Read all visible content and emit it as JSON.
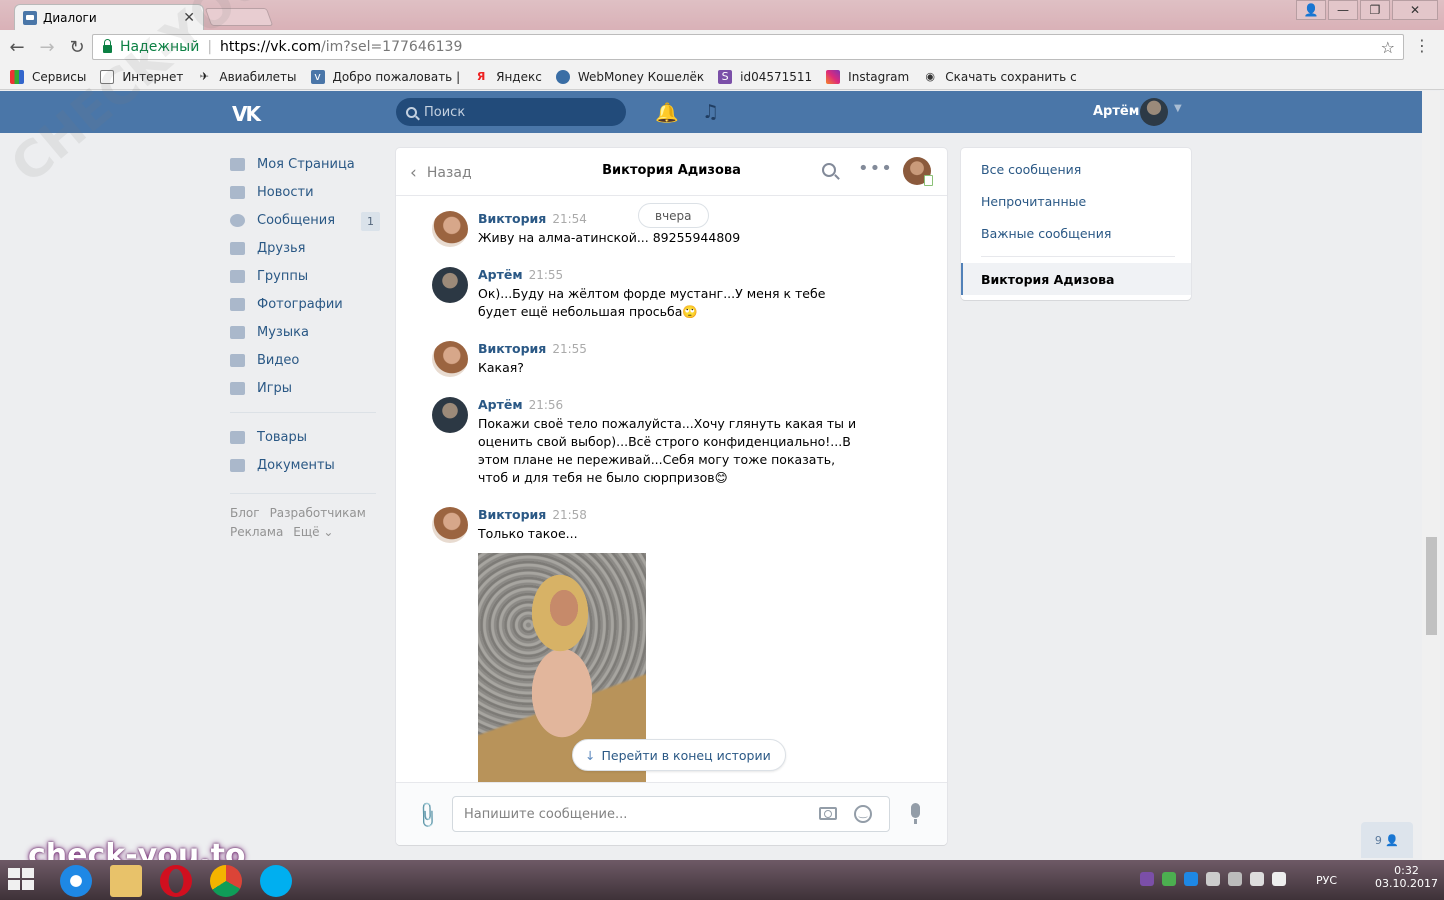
{
  "browser": {
    "tab_title": "Диалоги",
    "secure_label": "Надежный",
    "url_host": "https://vk.com",
    "url_rest": "/im?sel=177646139",
    "bookmarks": [
      "Сервисы",
      "Интернет",
      "Авиабилеты",
      "Добро пожаловать |",
      "Яндекс",
      "WebMoney Кошелёк",
      "id04571511",
      "Instagram",
      "Скачать сохранить с"
    ]
  },
  "vk_header": {
    "logo": "vk",
    "search_placeholder": "Поиск",
    "user_name": "Артём"
  },
  "left_menu": {
    "items": [
      {
        "label": "Моя Страница",
        "icon": "home-icon"
      },
      {
        "label": "Новости",
        "icon": "news-icon"
      },
      {
        "label": "Сообщения",
        "icon": "messages-icon",
        "count": "1"
      },
      {
        "label": "Друзья",
        "icon": "friends-icon"
      },
      {
        "label": "Группы",
        "icon": "groups-icon"
      },
      {
        "label": "Фотографии",
        "icon": "photos-icon"
      },
      {
        "label": "Музыка",
        "icon": "music-icon"
      },
      {
        "label": "Видео",
        "icon": "video-icon"
      },
      {
        "label": "Игры",
        "icon": "games-icon"
      }
    ],
    "items2": [
      {
        "label": "Товары",
        "icon": "goods-icon"
      },
      {
        "label": "Документы",
        "icon": "documents-icon"
      }
    ],
    "footer": [
      "Блог",
      "Разработчикам",
      "Реклама",
      "Ещё ⌄"
    ]
  },
  "chat": {
    "back_label": "Назад",
    "title": "Виктория Адизова",
    "date_pill": "вчера",
    "messages": [
      {
        "name": "Виктория",
        "time": "21:54",
        "text": "Живу на алма-атинской... 89255944809",
        "avatar": "viktoria"
      },
      {
        "name": "Артём",
        "time": "21:55",
        "text": "Ок)...Буду на жёлтом форде мустанг...У меня к тебе будет ещё небольшая просьба🙄",
        "avatar": "artem"
      },
      {
        "name": "Виктория",
        "time": "21:55",
        "text": "Какая?",
        "avatar": "viktoria"
      },
      {
        "name": "Артём",
        "time": "21:56",
        "text": "Покажи своё тело пожалуйста...Хочу глянуть какая ты и оценить свой выбор)...Всё строго конфиденциально!...В этом плане не переживай...Себя могу тоже показать, чтоб и для тебя не было сюрпризов😊",
        "avatar": "artem"
      },
      {
        "name": "Виктория",
        "time": "21:58",
        "text": "Только такое...",
        "avatar": "viktoria"
      }
    ],
    "goto_label": "Перейти в конец истории",
    "composer_placeholder": "Напишите сообщение..."
  },
  "right_panel": {
    "filters": [
      "Все сообщения",
      "Непрочитанные",
      "Важные сообщения"
    ],
    "active": "Виктория Адизова"
  },
  "friends_online": "9",
  "watermarks": {
    "diagonal": "CHECK-YOU.ME",
    "corner": "check-you.to"
  },
  "taskbar": {
    "lang": "РУС",
    "time": "0:32",
    "date": "03.10.2017"
  },
  "colors": {
    "vk_blue": "#4a76a8",
    "link": "#2a5885"
  }
}
